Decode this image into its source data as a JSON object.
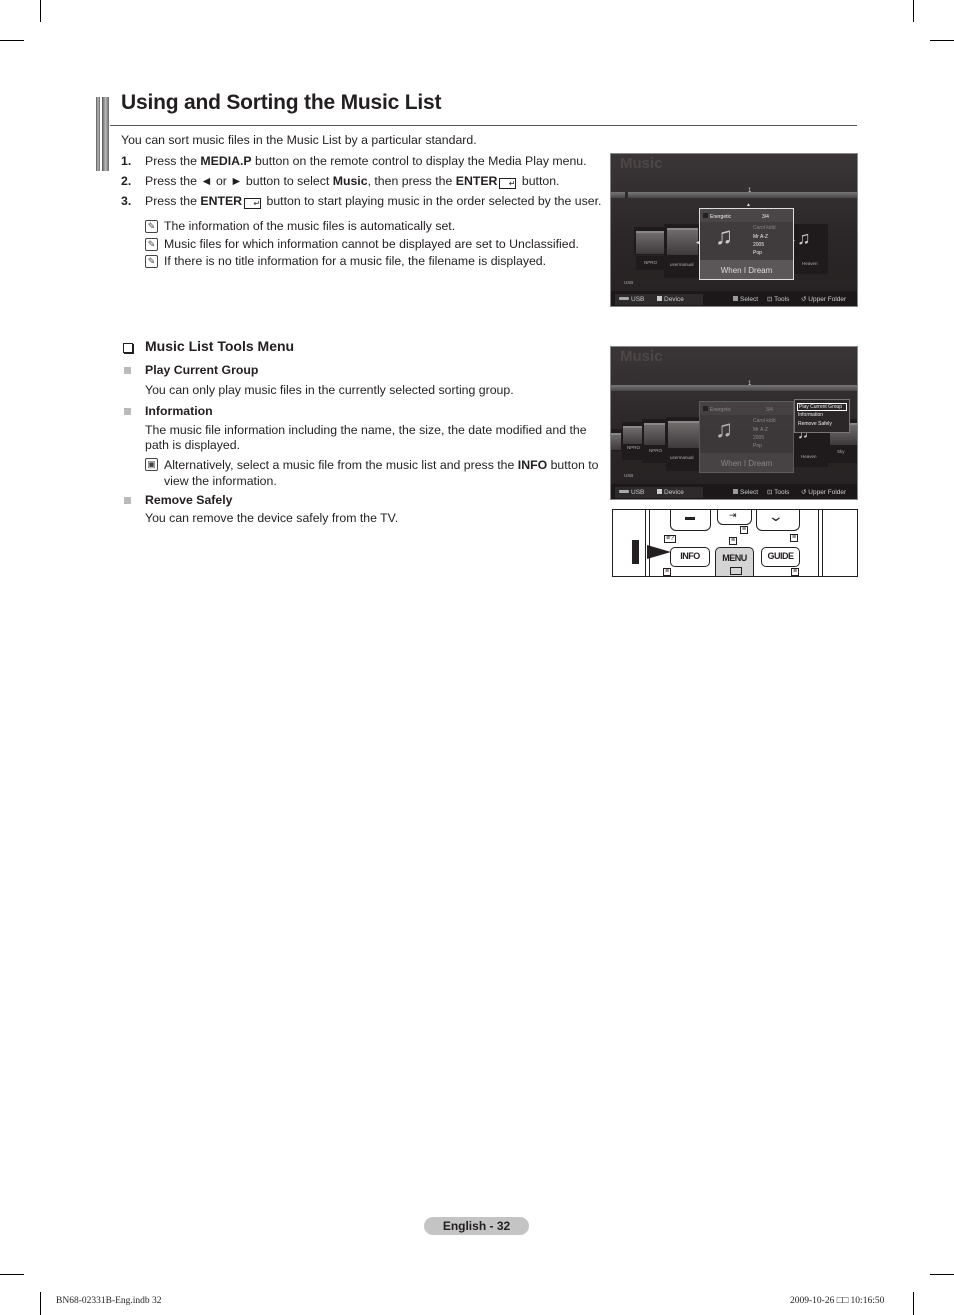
{
  "page": {
    "title": "Using and Sorting the Music List",
    "intro": "You can sort music files in the Music List by a particular standard.",
    "steps": [
      {
        "num": "1.",
        "parts": [
          "Press the ",
          "MEDIA.P",
          " button on the remote control to display the Media Play menu."
        ]
      },
      {
        "num": "2.",
        "parts": [
          "Press the ◄ or ► button to select ",
          "Music",
          ", then press the ",
          "ENTER",
          " button."
        ]
      },
      {
        "num": "3.",
        "parts": [
          "Press the ",
          "ENTER",
          " button to start playing music in the order selected by the user."
        ]
      }
    ],
    "notes": [
      "The information of the music files is automatically set.",
      "Music files for which information cannot be displayed are set to Unclassified.",
      "If there is no title information for a music file, the filename is displayed."
    ],
    "section": {
      "title": "Music List Tools Menu",
      "items": [
        {
          "heading": "Play Current Group",
          "desc": "You can only play music files in the currently selected sorting group."
        },
        {
          "heading": "Information",
          "desc_line1": "The music file information including the name, the size, the date modified and the",
          "desc_line2": "path is displayed.",
          "note_parts": [
            "Alternatively, select a music file from the music list and press the ",
            "INFO",
            " button to"
          ],
          "note_line2": "view the information."
        },
        {
          "heading": "Remove Safely",
          "desc": "You can remove the device safely from the TV."
        }
      ]
    },
    "page_label": "English - 32",
    "footer_file": "BN68-02331B-Eng.indb   32",
    "footer_date": "2009-10-26   □□ 10:16:50"
  },
  "screen1": {
    "title": "Music",
    "marker": "1",
    "folders": [
      "NPRO",
      "usermanual"
    ],
    "card": {
      "group": "Energetic",
      "count": "3/4",
      "artist": "Carol kidd",
      "sort": "Mr A-Z",
      "year": "2005",
      "genre": "Pop",
      "song": "When I Dream"
    },
    "right_item": "Heaven",
    "device": "USB",
    "footer": {
      "usb": "USB",
      "device": "Device",
      "select": "Select",
      "tools": "Tools",
      "upper": "Upper Folder"
    }
  },
  "screen2": {
    "title": "Music",
    "marker": "1",
    "folders": [
      "NPRO",
      "NPRO",
      "usermanual"
    ],
    "card": {
      "group": "Energetic",
      "count": "3/4",
      "artist": "Carol kidd",
      "sort": "Mr A-Z",
      "year": "2005",
      "genre": "Pop",
      "song": "When I Dream"
    },
    "right_items": [
      "Heaven",
      "Sky"
    ],
    "tools_menu": [
      "Play Current Group",
      "Information",
      "Remove Safely"
    ],
    "device": "USB",
    "footer": {
      "usb": "USB",
      "device": "Device",
      "select": "Select",
      "tools": "Tools",
      "upper": "Upper Folder"
    }
  },
  "remote": {
    "buttons": [
      "INFO",
      "MENU",
      "GUIDE"
    ]
  }
}
